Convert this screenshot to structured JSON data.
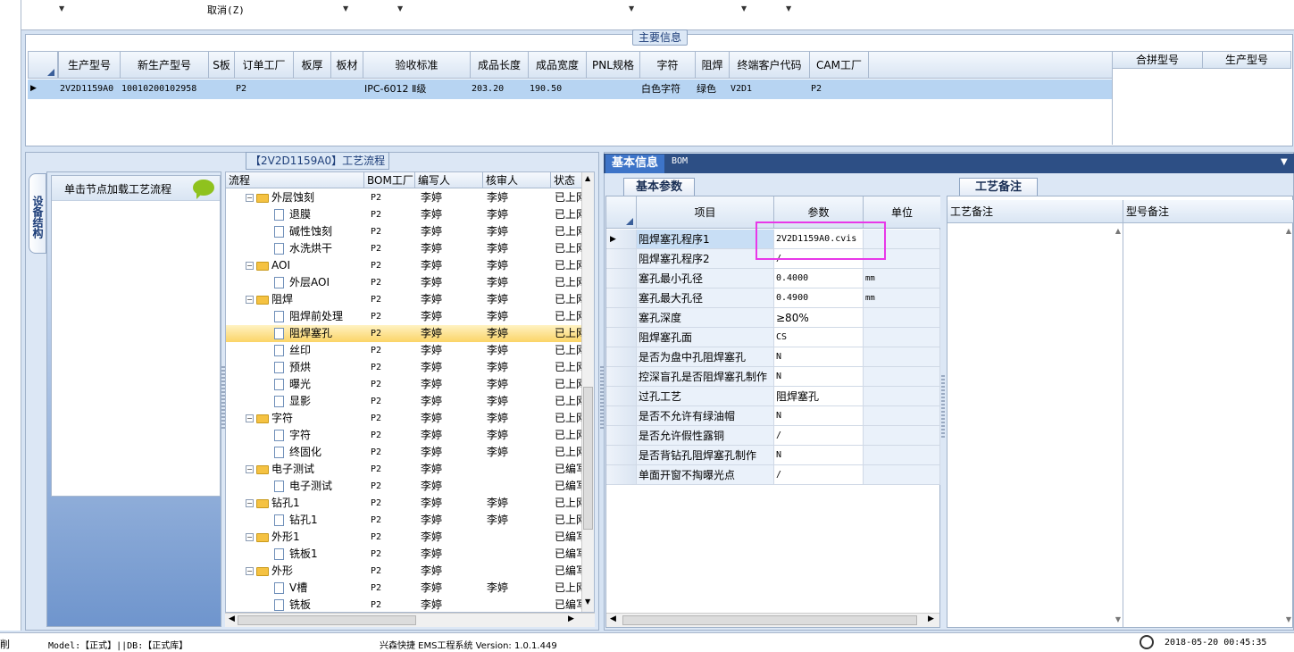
{
  "toolbar": {
    "cancel_label": "取消(Z)"
  },
  "main_info": {
    "title": "主要信息",
    "columns": [
      "生产型号",
      "新生产型号",
      "S板",
      "订单工厂",
      "板厚",
      "板材",
      "验收标准",
      "成品长度",
      "成品宽度",
      "PNL规格",
      "字符",
      "阻焊",
      "终端客户代码",
      "CAM工厂"
    ],
    "row": [
      "2V2D1159A0",
      "10010200102958",
      "",
      "P2",
      "",
      "",
      "IPC-6012 Ⅱ级",
      "203.20",
      "190.50",
      "",
      "白色字符",
      "绿色",
      "V2D1",
      "P2"
    ],
    "side_columns": [
      "合拼型号",
      "生产型号"
    ]
  },
  "process_flow": {
    "title": "【2V2D1159A0】工艺流程",
    "vertical_tab": "设备结构",
    "load_hint": "单击节点加载工艺流程",
    "columns": [
      "流程",
      "BOM工厂",
      "编写人",
      "核审人",
      "状态"
    ],
    "rows": [
      {
        "name": "外层蚀刻",
        "type": "folder",
        "factory": "P2",
        "writer": "李婷",
        "reviewer": "李婷",
        "status": "已上网"
      },
      {
        "name": "退膜",
        "type": "doc",
        "factory": "P2",
        "writer": "李婷",
        "reviewer": "李婷",
        "status": "已上网"
      },
      {
        "name": "碱性蚀刻",
        "type": "doc",
        "factory": "P2",
        "writer": "李婷",
        "reviewer": "李婷",
        "status": "已上网"
      },
      {
        "name": "水洗烘干",
        "type": "doc",
        "factory": "P2",
        "writer": "李婷",
        "reviewer": "李婷",
        "status": "已上网"
      },
      {
        "name": "AOI",
        "type": "folder",
        "factory": "P2",
        "writer": "李婷",
        "reviewer": "李婷",
        "status": "已上网"
      },
      {
        "name": "外层AOI",
        "type": "doc",
        "factory": "P2",
        "writer": "李婷",
        "reviewer": "李婷",
        "status": "已上网"
      },
      {
        "name": "阻焊",
        "type": "folder",
        "factory": "P2",
        "writer": "李婷",
        "reviewer": "李婷",
        "status": "已上网"
      },
      {
        "name": "阻焊前处理",
        "type": "doc",
        "factory": "P2",
        "writer": "李婷",
        "reviewer": "李婷",
        "status": "已上网"
      },
      {
        "name": "阻焊塞孔",
        "type": "doc",
        "factory": "P2",
        "writer": "李婷",
        "reviewer": "李婷",
        "status": "已上网"
      },
      {
        "name": "丝印",
        "type": "doc",
        "factory": "P2",
        "writer": "李婷",
        "reviewer": "李婷",
        "status": "已上网"
      },
      {
        "name": "预烘",
        "type": "doc",
        "factory": "P2",
        "writer": "李婷",
        "reviewer": "李婷",
        "status": "已上网"
      },
      {
        "name": "曝光",
        "type": "doc",
        "factory": "P2",
        "writer": "李婷",
        "reviewer": "李婷",
        "status": "已上网"
      },
      {
        "name": "显影",
        "type": "doc",
        "factory": "P2",
        "writer": "李婷",
        "reviewer": "李婷",
        "status": "已上网"
      },
      {
        "name": "字符",
        "type": "folder",
        "factory": "P2",
        "writer": "李婷",
        "reviewer": "李婷",
        "status": "已上网"
      },
      {
        "name": "字符",
        "type": "doc",
        "factory": "P2",
        "writer": "李婷",
        "reviewer": "李婷",
        "status": "已上网"
      },
      {
        "name": "终固化",
        "type": "doc",
        "factory": "P2",
        "writer": "李婷",
        "reviewer": "李婷",
        "status": "已上网"
      },
      {
        "name": "电子测试",
        "type": "folder",
        "factory": "P2",
        "writer": "李婷",
        "reviewer": "",
        "status": "已编写"
      },
      {
        "name": "电子测试",
        "type": "doc",
        "factory": "P2",
        "writer": "李婷",
        "reviewer": "",
        "status": "已编写"
      },
      {
        "name": "钻孔1",
        "type": "folder",
        "factory": "P2",
        "writer": "李婷",
        "reviewer": "李婷",
        "status": "已上网"
      },
      {
        "name": "钻孔1",
        "type": "doc",
        "factory": "P2",
        "writer": "李婷",
        "reviewer": "李婷",
        "status": "已上网"
      },
      {
        "name": "外形1",
        "type": "folder",
        "factory": "P2",
        "writer": "李婷",
        "reviewer": "",
        "status": "已编写"
      },
      {
        "name": "铣板1",
        "type": "doc",
        "factory": "P2",
        "writer": "李婷",
        "reviewer": "",
        "status": "已编写"
      },
      {
        "name": "外形",
        "type": "folder",
        "factory": "P2",
        "writer": "李婷",
        "reviewer": "",
        "status": "已编写"
      },
      {
        "name": "V槽",
        "type": "doc",
        "factory": "P2",
        "writer": "李婷",
        "reviewer": "李婷",
        "status": "已上网"
      },
      {
        "name": "铣板",
        "type": "doc",
        "factory": "P2",
        "writer": "李婷",
        "reviewer": "",
        "status": "已编写"
      }
    ]
  },
  "right_tabs": {
    "basic": "基本信息",
    "bom": "BOM",
    "basic_params": "基本参数",
    "process_remark": "工艺备注"
  },
  "params": {
    "columns": [
      "项目",
      "参数",
      "单位"
    ],
    "rows": [
      {
        "item": "阻焊塞孔程序1",
        "value": "2V2D1159A0.cvis",
        "unit": ""
      },
      {
        "item": "阻焊塞孔程序2",
        "value": "/",
        "unit": ""
      },
      {
        "item": "塞孔最小孔径",
        "value": "0.4000",
        "unit": "mm"
      },
      {
        "item": "塞孔最大孔径",
        "value": "0.4900",
        "unit": "mm"
      },
      {
        "item": "塞孔深度",
        "value": "≥80%",
        "unit": ""
      },
      {
        "item": "阻焊塞孔面",
        "value": "CS",
        "unit": ""
      },
      {
        "item": "是否为盘中孔阻焊塞孔",
        "value": "N",
        "unit": ""
      },
      {
        "item": "控深盲孔是否阻焊塞孔制作",
        "value": "N",
        "unit": ""
      },
      {
        "item": "过孔工艺",
        "value": "阻焊塞孔",
        "unit": ""
      },
      {
        "item": "是否不允许有绿油帽",
        "value": "N",
        "unit": ""
      },
      {
        "item": "是否允许假性露铜",
        "value": "/",
        "unit": ""
      },
      {
        "item": "是否背钻孔阻焊塞孔制作",
        "value": "N",
        "unit": ""
      },
      {
        "item": "单面开窗不掏曝光点",
        "value": "/",
        "unit": ""
      }
    ]
  },
  "remarks": {
    "col1": "工艺备注",
    "col2": "型号备注"
  },
  "status": {
    "left_cut": "削",
    "model": "Model:【正式】||DB:【正式库】",
    "app": "兴森快捷 EMS工程系统 Version: 1.0.1.449",
    "datetime": "2018-05-20 00:45:35"
  }
}
